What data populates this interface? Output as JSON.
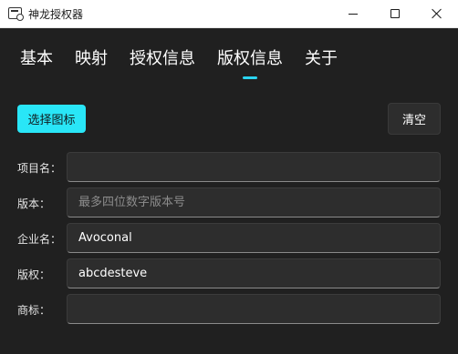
{
  "window": {
    "title": "神龙授权器"
  },
  "tabs": [
    {
      "label": "基本"
    },
    {
      "label": "映射"
    },
    {
      "label": "授权信息"
    },
    {
      "label": "版权信息"
    },
    {
      "label": "关于"
    }
  ],
  "active_tab": "版权信息",
  "toolbar": {
    "choose_icon_label": "选择图标",
    "clear_label": "清空"
  },
  "fields": [
    {
      "label": "项目名：",
      "value": "",
      "placeholder": ""
    },
    {
      "label": "版本：",
      "value": "",
      "placeholder": "最多四位数字版本号"
    },
    {
      "label": "企业名：",
      "value": "Avoconal",
      "placeholder": ""
    },
    {
      "label": "版权：",
      "value": "abcdesteve",
      "placeholder": ""
    },
    {
      "label": "商标：",
      "value": "",
      "placeholder": ""
    }
  ],
  "colors": {
    "accent": "#29e6f7",
    "background": "#202020",
    "field_bg": "#2d2d2d"
  }
}
